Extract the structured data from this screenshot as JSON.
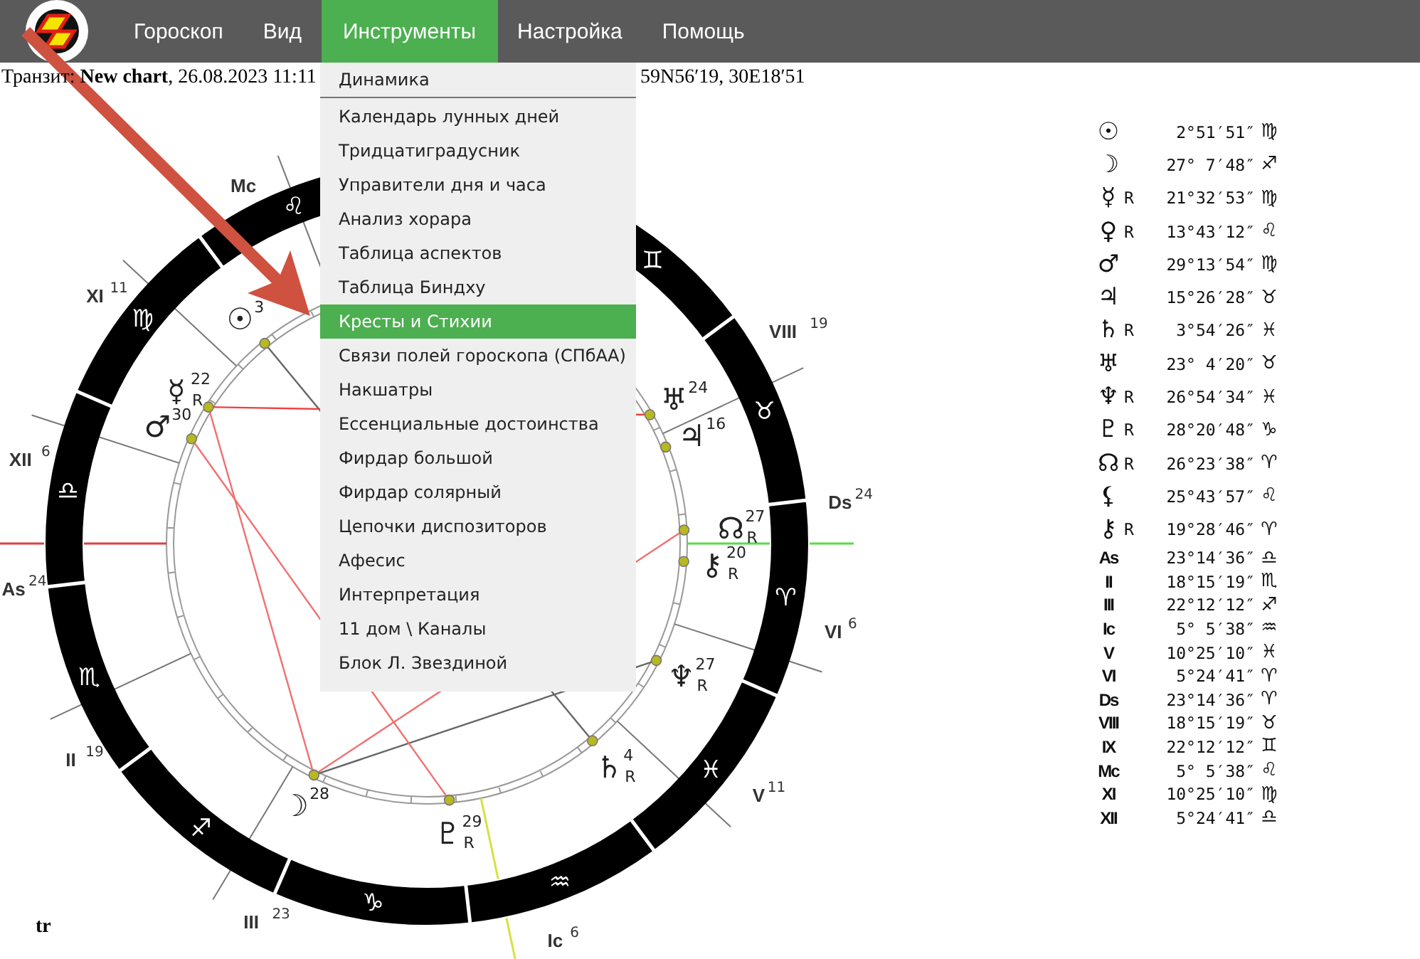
{
  "nav": {
    "items": [
      {
        "label": "Гороскоп",
        "selected": false
      },
      {
        "label": "Вид",
        "selected": false
      },
      {
        "label": "Инструменты",
        "selected": true
      },
      {
        "label": "Настройка",
        "selected": false
      },
      {
        "label": "Помощь",
        "selected": false
      }
    ]
  },
  "subtitle": {
    "left": "Транзит: **New chart**, 26.08.2023 11:11",
    "right": "59N56′19, 30E18′51"
  },
  "menu": {
    "items": [
      {
        "label": "Динамика",
        "selected": false
      },
      {
        "label": "Календарь лунных дней",
        "selected": false
      },
      {
        "label": "Тридцатиградусник",
        "selected": false
      },
      {
        "label": "Управители дня и часа",
        "selected": false
      },
      {
        "label": "Анализ хорара",
        "selected": false
      },
      {
        "label": "Таблица аспектов",
        "selected": false
      },
      {
        "label": "Таблица Биндху",
        "selected": false
      },
      {
        "label": "Кресты и Стихии",
        "selected": true
      },
      {
        "label": "Связи полей гороскопа (СПбАА)",
        "selected": false
      },
      {
        "label": "Накшатры",
        "selected": false
      },
      {
        "label": "Ессенциальные достоинства",
        "selected": false
      },
      {
        "label": "Фирдар большой",
        "selected": false
      },
      {
        "label": "Фирдар солярный",
        "selected": false
      },
      {
        "label": "Цепочки диспозиторов",
        "selected": false
      },
      {
        "label": "Афесис",
        "selected": false
      },
      {
        "label": "Интерпретация",
        "selected": false
      },
      {
        "label": "11 дом \\ Каналы",
        "selected": false
      },
      {
        "label": "Блок Л. Звездиной",
        "selected": false
      }
    ]
  },
  "wheel": {
    "houses": [
      {
        "label": "Mc",
        "kind": "leo"
      },
      {
        "label": "XI",
        "degree": "11",
        "kind": "virgo"
      },
      {
        "label": "VIII",
        "degree": "19",
        "kind": "taurus"
      },
      {
        "label": "XII",
        "degree": "6",
        "kind": "libra"
      },
      {
        "label": "Ds",
        "degree": "24",
        "kind": "aries",
        "color": "#55dd44"
      },
      {
        "label": "As",
        "degree": "24",
        "kind": "libra",
        "color": "#e04040"
      },
      {
        "label": "VI",
        "degree": "6",
        "kind": "aries"
      },
      {
        "label": "II",
        "degree": "19",
        "kind": "scorpio"
      },
      {
        "label": "V",
        "degree": "11",
        "kind": "pisces"
      },
      {
        "label": "III",
        "degree": "23",
        "kind": "sagittarius"
      },
      {
        "label": "Ic",
        "degree": "6",
        "kind": "aquarius",
        "color": "#d8e040"
      }
    ],
    "signs": [
      {
        "glyph": "♌",
        "kind": "leo"
      },
      {
        "glyph": "♊",
        "kind": "gemini"
      },
      {
        "glyph": "♍",
        "kind": "virgo"
      },
      {
        "glyph": "♉",
        "kind": "taurus"
      },
      {
        "glyph": "♎",
        "kind": "libra"
      },
      {
        "glyph": "♈",
        "kind": "aries"
      },
      {
        "glyph": "♏",
        "kind": "scorpio"
      },
      {
        "glyph": "♓",
        "kind": "pisces"
      },
      {
        "glyph": "♐",
        "kind": "sagittarius"
      },
      {
        "glyph": "♒",
        "kind": "aquarius"
      },
      {
        "glyph": "♑",
        "kind": "capricorn"
      }
    ],
    "planets": [
      {
        "glyph": "☉",
        "degree": "3",
        "kind": "virgo"
      },
      {
        "glyph": "☿",
        "degree": "22",
        "kind": "virgo",
        "retro": "R"
      },
      {
        "glyph": "♅",
        "degree": "24",
        "kind": "taurus"
      },
      {
        "glyph": "♂",
        "degree": "30",
        "kind": "virgo"
      },
      {
        "glyph": "♃",
        "degree": "16",
        "kind": "taurus"
      },
      {
        "glyph": "☊",
        "degree": "27",
        "kind": "aries",
        "retro": "R"
      },
      {
        "glyph": "⚷",
        "degree": "20",
        "kind": "aries",
        "retro": "R"
      },
      {
        "glyph": "♆",
        "degree": "27",
        "kind": "pisces",
        "retro": "R"
      },
      {
        "glyph": "♄",
        "degree": "4",
        "kind": "pisces",
        "retro": "R"
      },
      {
        "glyph": "☽",
        "degree": "28",
        "kind": "sagittarius"
      },
      {
        "glyph": "♇",
        "degree": "29",
        "kind": "capricorn",
        "retro": "R"
      }
    ],
    "corner_label": "tr"
  },
  "positions": [
    {
      "kind": "planet",
      "glyph": "☉",
      "position": "2°51′51″",
      "sign": "♍"
    },
    {
      "kind": "planet",
      "glyph": "☽",
      "position": "27° 7′48″",
      "sign": "♐"
    },
    {
      "kind": "planet",
      "glyph": "☿",
      "retro": "R",
      "position": "21°32′53″",
      "sign": "♍"
    },
    {
      "kind": "planet",
      "glyph": "♀",
      "retro": "R",
      "position": "13°43′12″",
      "sign": "♌"
    },
    {
      "kind": "planet",
      "glyph": "♂",
      "position": "29°13′54″",
      "sign": "♍"
    },
    {
      "kind": "planet",
      "glyph": "♃",
      "position": "15°26′28″",
      "sign": "♉"
    },
    {
      "kind": "planet",
      "glyph": "♄",
      "retro": "R",
      "position": "3°54′26″",
      "sign": "♓"
    },
    {
      "kind": "planet",
      "glyph": "♅",
      "position": "23° 4′20″",
      "sign": "♉"
    },
    {
      "kind": "planet",
      "glyph": "♆",
      "retro": "R",
      "position": "26°54′34″",
      "sign": "♓"
    },
    {
      "kind": "planet",
      "glyph": "♇",
      "retro": "R",
      "position": "28°20′48″",
      "sign": "♑"
    },
    {
      "kind": "planet",
      "glyph": "☊",
      "retro": "R",
      "position": "26°23′38″",
      "sign": "♈"
    },
    {
      "kind": "planet",
      "glyph": "⚸",
      "position": "25°43′57″",
      "sign": "♌"
    },
    {
      "kind": "planet",
      "glyph": "⚷",
      "retro": "R",
      "position": "19°28′46″",
      "sign": "♈"
    },
    {
      "kind": "house",
      "glyph": "As",
      "position": "23°14′36″",
      "sign": "♎"
    },
    {
      "kind": "house",
      "glyph": "II",
      "position": "18°15′19″",
      "sign": "♏"
    },
    {
      "kind": "house",
      "glyph": "III",
      "position": "22°12′12″",
      "sign": "♐"
    },
    {
      "kind": "house",
      "glyph": "Ic",
      "position": "5° 5′38″",
      "sign": "♒"
    },
    {
      "kind": "house",
      "glyph": "V",
      "position": "10°25′10″",
      "sign": "♓"
    },
    {
      "kind": "house",
      "glyph": "VI",
      "position": "5°24′41″",
      "sign": "♈"
    },
    {
      "kind": "house",
      "glyph": "Ds",
      "position": "23°14′36″",
      "sign": "♈"
    },
    {
      "kind": "house",
      "glyph": "VIII",
      "position": "18°15′19″",
      "sign": "♉"
    },
    {
      "kind": "house",
      "glyph": "IX",
      "position": "22°12′12″",
      "sign": "♊"
    },
    {
      "kind": "house",
      "glyph": "Mc",
      "position": "5° 5′38″",
      "sign": "♌"
    },
    {
      "kind": "house",
      "glyph": "XI",
      "position": "10°25′10″",
      "sign": "♍"
    },
    {
      "kind": "house",
      "glyph": "XII",
      "position": "5°24′41″",
      "sign": "♎"
    }
  ]
}
